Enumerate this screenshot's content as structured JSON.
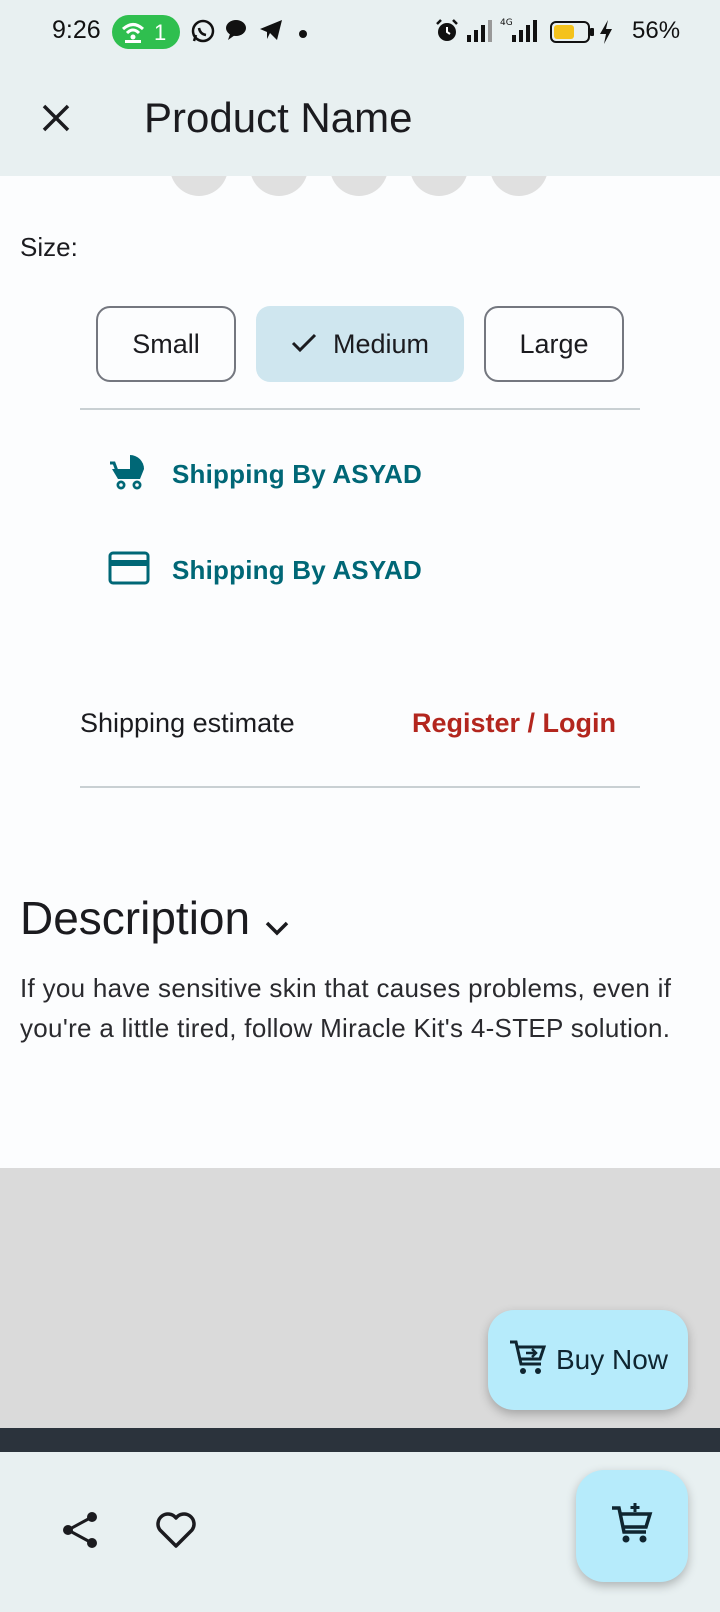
{
  "status_bar": {
    "time": "9:26",
    "hotspot_count": "1",
    "battery_percent": "56%",
    "icons": [
      "hotspot-icon",
      "whatsapp-icon",
      "chat-icon",
      "telegram-icon",
      "dot-icon",
      "alarm-icon",
      "signal-icon",
      "4g-signal-icon",
      "battery-icon",
      "charging-icon"
    ]
  },
  "app_bar": {
    "title": "Product Name",
    "close_icon": "close-icon"
  },
  "size": {
    "label": "Size:",
    "options": [
      "Small",
      "Medium",
      "Large"
    ],
    "selected": "Medium"
  },
  "shipping": {
    "items": [
      {
        "icon": "stroller-icon",
        "label": "Shipping By ASYAD"
      },
      {
        "icon": "credit-card-icon",
        "label": "Shipping By ASYAD"
      }
    ],
    "estimate_label": "Shipping estimate",
    "login_link": "Register / Login"
  },
  "description": {
    "title": "Description",
    "text": "If you have sensitive skin that causes problems, even if you're a little tired, follow Miracle Kit's 4-STEP solution."
  },
  "buy_now": {
    "label": "Buy Now",
    "icon": "add-to-cart-icon"
  },
  "bottom_bar": {
    "icons": [
      "share-icon",
      "heart-icon",
      "add-to-cart-icon"
    ]
  },
  "colors": {
    "accent": "#006776",
    "link_red": "#b3261e",
    "selected_chip": "#cfe6ef",
    "fab": "#b6ebfb",
    "bar_bg": "#e8f0f1"
  }
}
